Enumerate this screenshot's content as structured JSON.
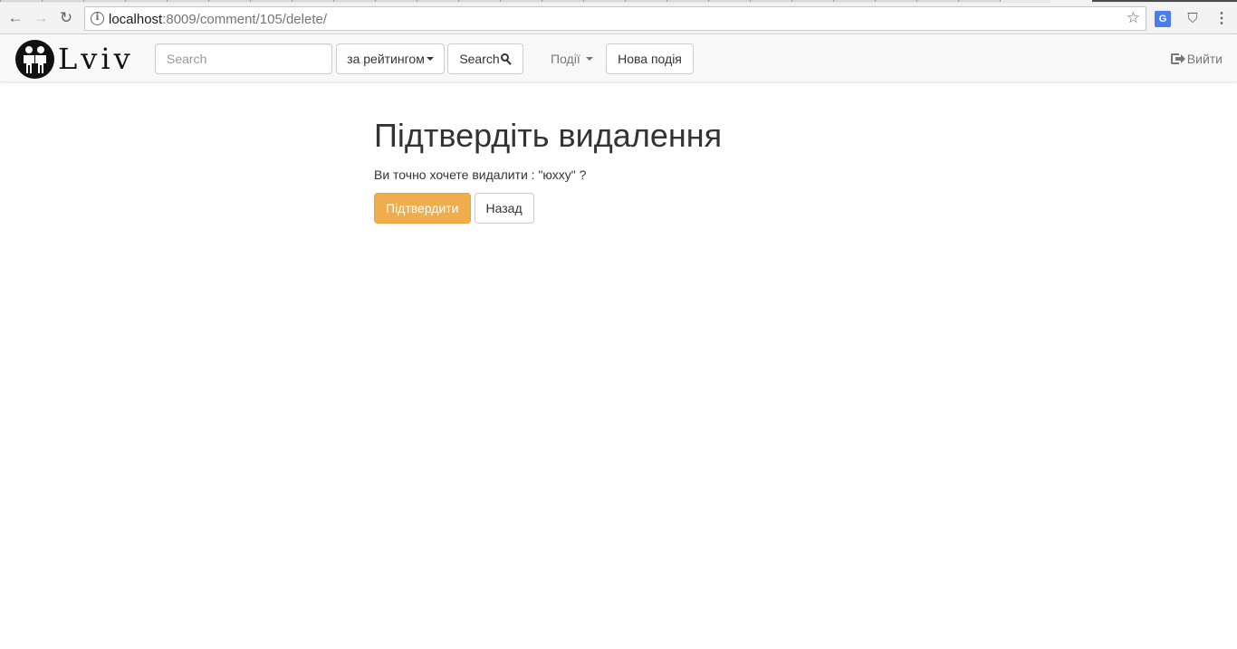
{
  "browser": {
    "url_host": "localhost",
    "url_rest": ":8009/comment/105/delete/",
    "back_icon": "←",
    "forward_icon": "→",
    "reload_icon": "↻",
    "bookmark_icon": "☆",
    "translate_ext_label": "G",
    "menu_icon": "⋮"
  },
  "navbar": {
    "logo_text": "Lviv",
    "search_placeholder": "Search",
    "sort_label": "за рейтингом",
    "search_button_label": "Search",
    "events_menu_label": "Події",
    "new_event_label": "Нова подія",
    "logout_label": "Вийти"
  },
  "main": {
    "title": "Підтвердіть видалення",
    "message": "Ви точно хочете видалити : \"юхху\" ?",
    "confirm_label": "Підтвердити",
    "back_label": "Назад"
  },
  "colors": {
    "warning": "#f0ad4e",
    "navbar_bg": "#f8f8f8"
  }
}
